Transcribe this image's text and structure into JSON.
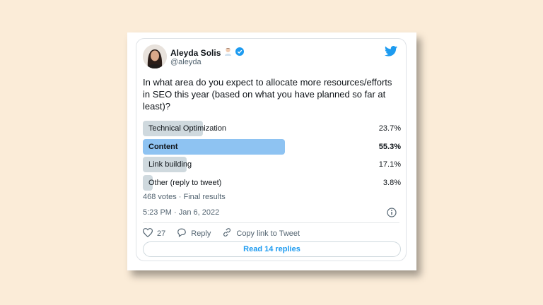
{
  "tweet": {
    "author": {
      "name": "Aleyda Solis",
      "handle": "@aleyda"
    },
    "question": "In what area do you expect to allocate more resources/efforts in SEO this year (based on what you have planned so far at least)?",
    "poll": {
      "options": [
        {
          "label": "Technical Optimization",
          "percent_text": "23.7%",
          "percent": 23.7
        },
        {
          "label": "Content",
          "percent_text": "55.3%",
          "percent": 55.3
        },
        {
          "label": "Link building",
          "percent_text": "17.1%",
          "percent": 17.1
        },
        {
          "label": "Other (reply to tweet)",
          "percent_text": "3.8%",
          "percent": 3.8
        }
      ],
      "summary": "468 votes · Final results"
    },
    "timestamp": "5:23 PM · Jan 6, 2022",
    "actions": {
      "likes": "27",
      "reply_label": "Reply",
      "copy_link_label": "Copy link to Tweet"
    },
    "read_replies": "Read 14 replies"
  },
  "colors": {
    "twitter_blue": "#1d9bf0",
    "winner_bar": "#8ec3f2",
    "bar": "#cfd9de",
    "background": "#fbecd8"
  },
  "icons": [
    "verified-badge-icon",
    "twitter-bird-icon",
    "info-icon",
    "heart-icon",
    "reply-icon",
    "link-icon"
  ]
}
